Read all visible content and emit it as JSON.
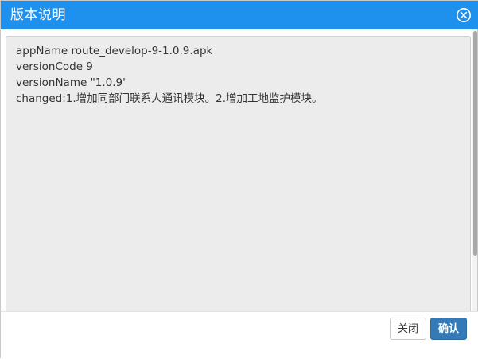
{
  "dialog": {
    "title": "版本说明",
    "close_icon": "circle-x-icon",
    "content_lines": [
      "appName route_develop-9-1.0.9.apk",
      "versionCode 9",
      "versionName \"1.0.9\"",
      "changed:1.增加同部门联系人通讯模块。2.增加工地监护模块。"
    ],
    "buttons": {
      "close_label": "关闭",
      "confirm_label": "确认"
    }
  },
  "colors": {
    "title_bar": "#1e90ee",
    "content_bg": "#ececec",
    "confirm_button": "#337ab7"
  }
}
